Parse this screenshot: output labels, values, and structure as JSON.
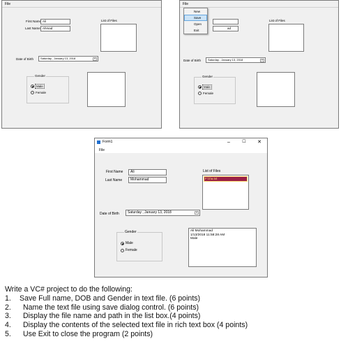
{
  "form_left": {
    "menu": {
      "file": "File"
    },
    "first_name_label": "First Name",
    "first_name_value": "Ali",
    "last_name_label": "Last Name",
    "last_name_value": "Ahmad",
    "list_label": "List of Files",
    "dob_label": "Date of Birth",
    "dob_value": "Saturday ,  January  13, 2018",
    "gender_label": "Gender",
    "male_label": "Male",
    "female_label": "Female",
    "male_checked": true
  },
  "form_right": {
    "menu": {
      "file": "File",
      "items": [
        "New",
        "Save",
        "Open",
        "Exit"
      ],
      "highlighted": "Save"
    },
    "last_name_partial": "ad",
    "list_label": "List of Files",
    "dob_label": "Date of Birth",
    "dob_value": "Saturday ,  January  13, 2018",
    "gender_label": "Gender",
    "male_label": "Male",
    "female_label": "Female",
    "male_checked": true
  },
  "form_main": {
    "title": "Form1",
    "controls": {
      "minimize": "–",
      "maximize": "☐",
      "close": "✕"
    },
    "menu": {
      "file": "File"
    },
    "first_name_label": "First Name",
    "first_name_value": "Ali",
    "last_name_label": "Last Name",
    "last_name_value": "Mohammad",
    "list_label": "List of Files",
    "list_items": [
      "F:\\z\\a.txt"
    ],
    "dob_label": "Date of Birth",
    "dob_value": "Saturday ,  January  13, 2018",
    "gender_label": "Gender",
    "male_label": "Male",
    "female_label": "Female",
    "male_checked": true,
    "rich_text_lines": [
      "Ali Mohammad",
      "1/13/2018 11:58:28 AM",
      "Male"
    ]
  },
  "task": {
    "intro": "Write a VC# project to do the following:",
    "items": [
      {
        "num": "1.",
        "text": "Save Full name, DOB and Gender in text file. (6 points)"
      },
      {
        "num": "2.",
        "text": "Name the text file using save dialog control. (6 points)"
      },
      {
        "num": "3.",
        "text": "Display the file name and path in the list box.(4 points)"
      },
      {
        "num": "4.",
        "text": "Display the contents of the selected text file in rich text box (4 points)"
      },
      {
        "num": "5.",
        "text": "Use Exit to close the program (2 points)"
      }
    ]
  }
}
